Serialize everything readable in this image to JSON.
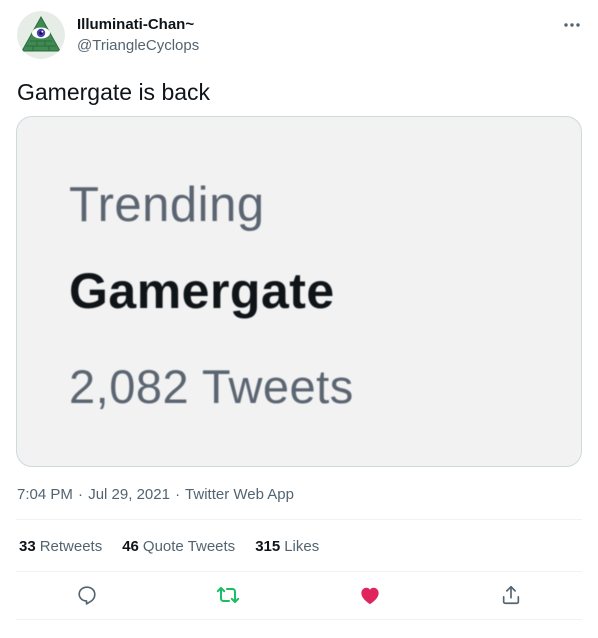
{
  "user": {
    "display_name": "Illuminati-Chan~",
    "handle": "@TriangleCyclops",
    "avatar_icon": "illuminati-eye-avatar"
  },
  "more_icon": "ellipsis-icon",
  "tweet": {
    "text": "Gamergate is back",
    "media": {
      "line1": "Trending",
      "line2": "Gamergate",
      "line3": "2,082 Tweets"
    }
  },
  "meta": {
    "time": "7:04 PM",
    "separator": "·",
    "date": "Jul 29, 2021",
    "source": "Twitter Web App"
  },
  "stats": {
    "retweets": {
      "count": "33",
      "label": "Retweets"
    },
    "quote_tweets": {
      "count": "46",
      "label": "Quote Tweets"
    },
    "likes": {
      "count": "315",
      "label": "Likes"
    }
  },
  "actions": {
    "reply_icon": "reply-icon",
    "retweet_icon": "retweet-icon",
    "like_icon": "heart-icon",
    "share_icon": "share-icon"
  },
  "colors": {
    "retweet_active": "#17bf63",
    "like_active": "#e0245e",
    "secondary_text": "#536471"
  }
}
